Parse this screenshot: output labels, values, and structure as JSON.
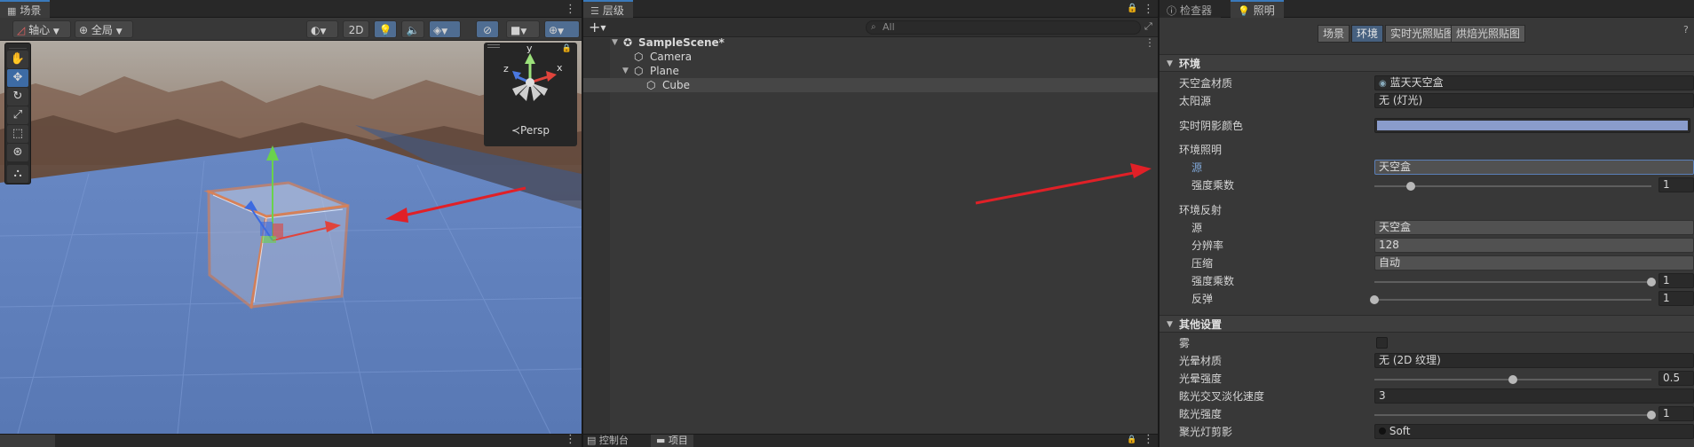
{
  "scene_panel": {
    "tab_label": "场景",
    "tab_icon": "grid-icon",
    "toolbar": {
      "pivot_label": "轴心",
      "global_label": "全局",
      "mode_2d_label": "2D"
    },
    "tools": [
      "hand-tool",
      "move-tool",
      "rotate-tool",
      "scale-tool",
      "rect-tool",
      "transform-tool",
      "custom-tool"
    ],
    "gizmo": {
      "axis_y": "y",
      "axis_x": "x",
      "axis_z": "z",
      "projection_label": "≺Persp"
    }
  },
  "hierarchy_panel": {
    "tab_label": "层级",
    "add_label": "+",
    "search_placeholder": "All",
    "scene_name": "SampleScene*",
    "items": [
      {
        "label": "Camera"
      },
      {
        "label": "Plane"
      },
      {
        "label": "Cube"
      }
    ],
    "bottom_tabs": [
      "控制台",
      "项目"
    ]
  },
  "inspector_panel": {
    "tabs": [
      "检查器",
      "照明"
    ],
    "lighting_tabs": [
      "场景",
      "环境",
      "实时光照贴图",
      "烘焙光照贴图"
    ],
    "active_lighting_tab": "环境",
    "environment": {
      "header": "环境",
      "skybox_label": "天空盒材质",
      "skybox_value": "蓝天天空盒",
      "sun_label": "太阳源",
      "sun_value": "无 (灯光)",
      "shadow_color_label": "实时阴影颜色",
      "shadow_color": "#8a9ccc",
      "ambient_header": "环境照明",
      "ambient_source_label": "源",
      "ambient_source_value": "天空盒",
      "ambient_intensity_label": "强度乘数",
      "ambient_intensity_value": "1",
      "ambient_intensity_fraction": 0.13,
      "reflection_header": "环境反射",
      "reflection_source_label": "源",
      "reflection_source_value": "天空盒",
      "resolution_label": "分辨率",
      "resolution_value": "128",
      "compression_label": "压缩",
      "compression_value": "自动",
      "reflection_intensity_label": "强度乘数",
      "reflection_intensity_value": "1",
      "reflection_intensity_fraction": 1.0,
      "bounces_label": "反弹",
      "bounces_value": "1",
      "bounces_fraction": 0.0
    },
    "other": {
      "header": "其他设置",
      "fog_label": "雾",
      "halo_label": "光晕材质",
      "halo_value": "无 (2D 纹理)",
      "halo_strength_label": "光晕强度",
      "halo_strength_value": "0.5",
      "halo_strength_fraction": 0.5,
      "flare_fade_label": "眩光交叉淡化速度",
      "flare_fade_value": "3",
      "flare_strength_label": "眩光强度",
      "flare_strength_value": "1",
      "flare_strength_fraction": 1.0,
      "spot_cookie_label": "聚光灯剪影",
      "spot_cookie_value": "Soft"
    }
  },
  "colors": {
    "accent": "#3a79bb",
    "arrow_red": "#e02027",
    "selection_orange": "#f7813c"
  }
}
